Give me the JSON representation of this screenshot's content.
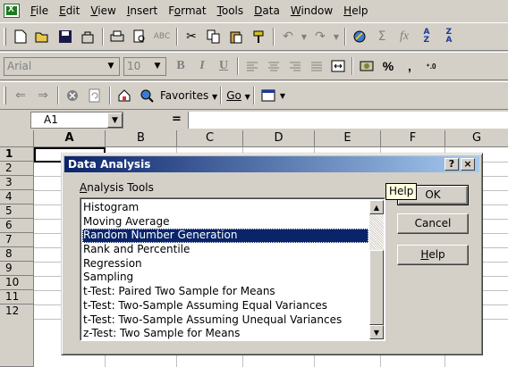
{
  "menubar": {
    "items": [
      "File",
      "Edit",
      "View",
      "Insert",
      "Format",
      "Tools",
      "Data",
      "Window",
      "Help"
    ],
    "underline": [
      "F",
      "E",
      "V",
      "I",
      "o",
      "T",
      "D",
      "W",
      "H"
    ]
  },
  "toolbar_format": {
    "font_name": "Arial",
    "font_size": "10",
    "bold": "B",
    "italic": "I",
    "underline": "U",
    "percent": "%",
    "comma": ","
  },
  "toolbar_web": {
    "favorites_label": "Favorites",
    "go_label": "Go"
  },
  "formula_bar": {
    "name_box": "A1",
    "equals": "="
  },
  "grid": {
    "columns": [
      "A",
      "B",
      "C",
      "D",
      "E",
      "F",
      "G"
    ],
    "rows": [
      "1",
      "2",
      "3",
      "4",
      "5",
      "6",
      "7",
      "8",
      "9",
      "10",
      "11",
      "12"
    ]
  },
  "dialog": {
    "title": "Data Analysis",
    "help_glyph": "?",
    "close_glyph": "×",
    "tools_label": "Analysis Tools",
    "items": [
      "Histogram",
      "Moving Average",
      "Random Number Generation",
      "Rank and Percentile",
      "Regression",
      "Sampling",
      "t-Test: Paired Two Sample for Means",
      "t-Test: Two-Sample Assuming Equal Variances",
      "t-Test: Two-Sample Assuming Unequal Variances",
      "z-Test: Two Sample for Means"
    ],
    "selected_index": 2,
    "ok_label": "OK",
    "cancel_label": "Cancel",
    "help_label": "Help",
    "tooltip": "Help"
  },
  "colors": {
    "title_bar": "#0a246a",
    "selection": "#0a246a",
    "face": "#d4d0c8"
  }
}
